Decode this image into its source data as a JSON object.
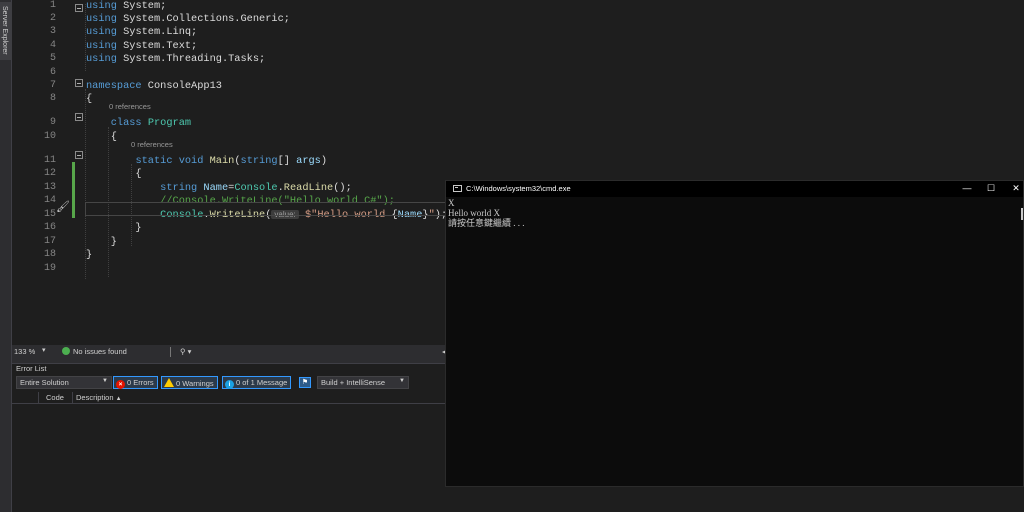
{
  "sidebar": {
    "server_explorer": "Server Explorer"
  },
  "editor": {
    "lines": [
      {
        "n": "1",
        "segs": [
          {
            "c": "kw",
            "t": "using"
          },
          {
            "c": "",
            "t": " System;"
          }
        ]
      },
      {
        "n": "2",
        "segs": [
          {
            "c": "kw",
            "t": "using"
          },
          {
            "c": "",
            "t": " System.Collections.Generic;"
          }
        ]
      },
      {
        "n": "3",
        "segs": [
          {
            "c": "kw",
            "t": "using"
          },
          {
            "c": "",
            "t": " System.Linq;"
          }
        ]
      },
      {
        "n": "4",
        "segs": [
          {
            "c": "kw",
            "t": "using"
          },
          {
            "c": "",
            "t": " System.Text;"
          }
        ]
      },
      {
        "n": "5",
        "segs": [
          {
            "c": "kw",
            "t": "using"
          },
          {
            "c": "",
            "t": " System.Threading.Tasks;"
          }
        ]
      },
      {
        "n": "6",
        "segs": []
      },
      {
        "n": "7",
        "segs": [
          {
            "c": "kw",
            "t": "namespace"
          },
          {
            "c": "",
            "t": " ConsoleApp13"
          }
        ]
      },
      {
        "n": "8",
        "segs": [
          {
            "c": "",
            "t": "{"
          }
        ]
      },
      {
        "n": "9",
        "segs": [
          {
            "c": "",
            "t": "    "
          },
          {
            "c": "kw",
            "t": "class"
          },
          {
            "c": "",
            "t": " "
          },
          {
            "c": "ty",
            "t": "Program"
          }
        ]
      },
      {
        "n": "10",
        "segs": [
          {
            "c": "",
            "t": "    {"
          }
        ]
      },
      {
        "n": "11",
        "segs": [
          {
            "c": "",
            "t": "        "
          },
          {
            "c": "kw",
            "t": "static"
          },
          {
            "c": "",
            "t": " "
          },
          {
            "c": "kw",
            "t": "void"
          },
          {
            "c": "",
            "t": " "
          },
          {
            "c": "fn",
            "t": "Main"
          },
          {
            "c": "",
            "t": "("
          },
          {
            "c": "kw",
            "t": "string"
          },
          {
            "c": "",
            "t": "[] "
          },
          {
            "c": "pr",
            "t": "args"
          },
          {
            "c": "",
            "t": ")"
          }
        ]
      },
      {
        "n": "12",
        "segs": [
          {
            "c": "",
            "t": "        {"
          }
        ]
      },
      {
        "n": "13",
        "segs": [
          {
            "c": "",
            "t": "            "
          },
          {
            "c": "kw",
            "t": "string"
          },
          {
            "c": "",
            "t": " "
          },
          {
            "c": "pr",
            "t": "Name"
          },
          {
            "c": "",
            "t": "="
          },
          {
            "c": "ty",
            "t": "Console"
          },
          {
            "c": "",
            "t": "."
          },
          {
            "c": "fn",
            "t": "ReadLine"
          },
          {
            "c": "",
            "t": "();"
          }
        ]
      },
      {
        "n": "14",
        "segs": [
          {
            "c": "",
            "t": "            "
          },
          {
            "c": "cm",
            "t": "//Console.WriteLine(\"Hello world C#\");"
          }
        ]
      },
      {
        "n": "15",
        "segs": [
          {
            "c": "",
            "t": "            "
          },
          {
            "c": "ty",
            "t": "Console"
          },
          {
            "c": "",
            "t": "."
          },
          {
            "c": "fn",
            "t": "WriteLine"
          },
          {
            "c": "",
            "t": "("
          },
          {
            "c": "hint",
            "t": "value:"
          },
          {
            "c": "",
            "t": " "
          },
          {
            "c": "st",
            "t": "$\"Hello world "
          },
          {
            "c": "",
            "t": "{"
          },
          {
            "c": "pr",
            "t": "Name"
          },
          {
            "c": "",
            "t": "}"
          },
          {
            "c": "st",
            "t": "\""
          },
          {
            "c": "",
            "t": ");"
          }
        ]
      },
      {
        "n": "16",
        "segs": [
          {
            "c": "",
            "t": "        }"
          }
        ]
      },
      {
        "n": "17",
        "segs": [
          {
            "c": "",
            "t": "    }"
          }
        ]
      },
      {
        "n": "18",
        "segs": [
          {
            "c": "",
            "t": "}"
          }
        ]
      },
      {
        "n": "19",
        "segs": []
      }
    ],
    "refs": [
      "0 references",
      "0 references"
    ]
  },
  "status": {
    "zoom": "133 %",
    "issues": "No issues found"
  },
  "error_list": {
    "title": "Error List",
    "scope": "Entire Solution",
    "errors": "0 Errors",
    "warnings": "0 Warnings",
    "messages": "0 of 1 Message",
    "build": "Build + IntelliSense",
    "col_code": "Code",
    "col_desc": "Description"
  },
  "cmd": {
    "title": "C:\\Windows\\system32\\cmd.exe",
    "output": "X\nHello world X\n請按任意鍵繼續 . . ."
  }
}
